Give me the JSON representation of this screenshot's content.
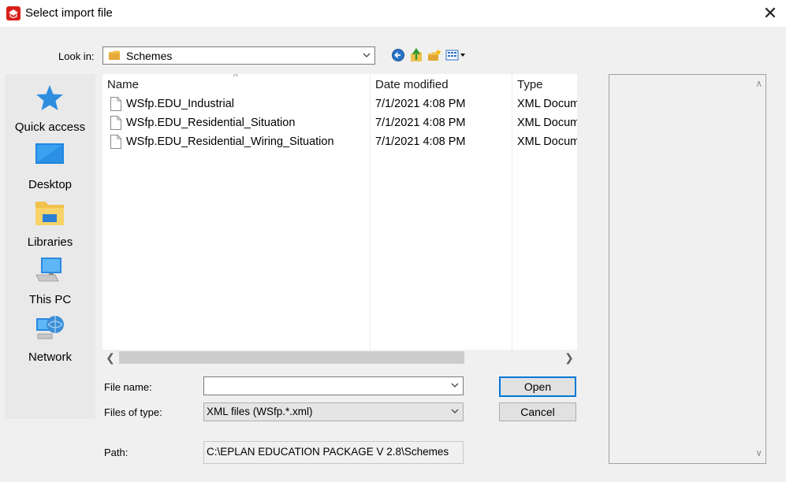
{
  "window": {
    "title": "Select import file",
    "app_icon": "eplan-app-icon",
    "close_glyph": "✕"
  },
  "toolbar": {
    "lookin_label": "Look in:",
    "lookin_value": "Schemes",
    "buttons": [
      "back-icon",
      "up-folder-icon",
      "new-folder-icon",
      "view-menu-icon"
    ]
  },
  "places": [
    {
      "label": "Quick access",
      "icon": "star-icon"
    },
    {
      "label": "Desktop",
      "icon": "desktop-icon"
    },
    {
      "label": "Libraries",
      "icon": "libraries-icon"
    },
    {
      "label": "This PC",
      "icon": "computer-icon"
    },
    {
      "label": "Network",
      "icon": "network-icon"
    }
  ],
  "file_list": {
    "columns": [
      "Name",
      "Date modified",
      "Type"
    ],
    "sort_glyph": "^",
    "rows": [
      {
        "name": "WSfp.EDU_Industrial",
        "date": "7/1/2021 4:08 PM",
        "type": "XML Docum"
      },
      {
        "name": "WSfp.EDU_Residential_Situation",
        "date": "7/1/2021 4:08 PM",
        "type": "XML Docum"
      },
      {
        "name": "WSfp.EDU_Residential_Wiring_Situation",
        "date": "7/1/2021 4:08 PM",
        "type": "XML Docum"
      }
    ]
  },
  "form": {
    "filename_label": "File name:",
    "filename_value": "",
    "filetype_label": "Files of type:",
    "filetype_value": "XML files (WSfp.*.xml)",
    "path_label": "Path:",
    "path_value": "C:\\EPLAN EDUCATION PACKAGE V 2.8\\Schemes"
  },
  "buttons": {
    "open": "Open",
    "cancel": "Cancel"
  },
  "colors": {
    "accent": "#0078d7",
    "app_icon": "#d91e18"
  }
}
